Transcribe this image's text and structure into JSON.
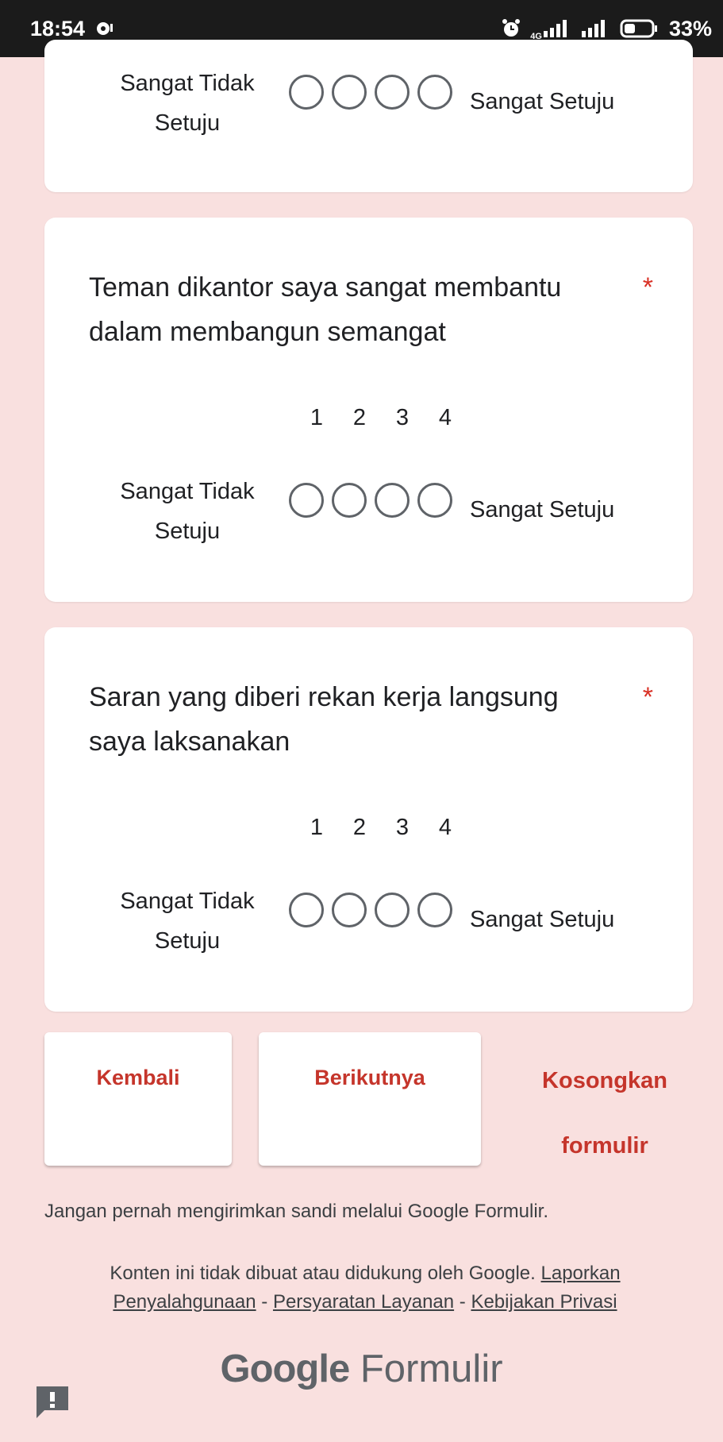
{
  "status_bar": {
    "time": "18:54",
    "network": "4G",
    "battery": "33%"
  },
  "questions": [
    {
      "low_label": "Sangat Tidak Setuju",
      "high_label": "Sangat Setuju"
    },
    {
      "title": "Teman dikantor saya sangat membantu dalam membangun semangat",
      "required": "*",
      "scale": [
        "1",
        "2",
        "3",
        "4"
      ],
      "low_label": "Sangat Tidak Setuju",
      "high_label": "Sangat Setuju"
    },
    {
      "title": "Saran yang diberi rekan kerja langsung saya laksanakan",
      "required": "*",
      "scale": [
        "1",
        "2",
        "3",
        "4"
      ],
      "low_label": "Sangat Tidak Setuju",
      "high_label": "Sangat Setuju"
    }
  ],
  "nav": {
    "back": "Kembali",
    "next": "Berikutnya",
    "clear": "Kosongkan formulir"
  },
  "footer": {
    "warning": "Jangan pernah mengirimkan sandi melalui Google Formulir.",
    "disclaimer": "Konten ini tidak dibuat atau didukung oleh Google.",
    "report_link": "Laporkan Penyalahgunaan",
    "sep": "-",
    "terms_link": "Persyaratan Layanan",
    "privacy_link": "Kebijakan Privasi",
    "brand_google": "Google",
    "brand_product": "Formulir"
  },
  "icons": {
    "status": [
      "alarm-icon",
      "signal-icon",
      "battery-icon"
    ],
    "feedback": "feedback-icon"
  }
}
